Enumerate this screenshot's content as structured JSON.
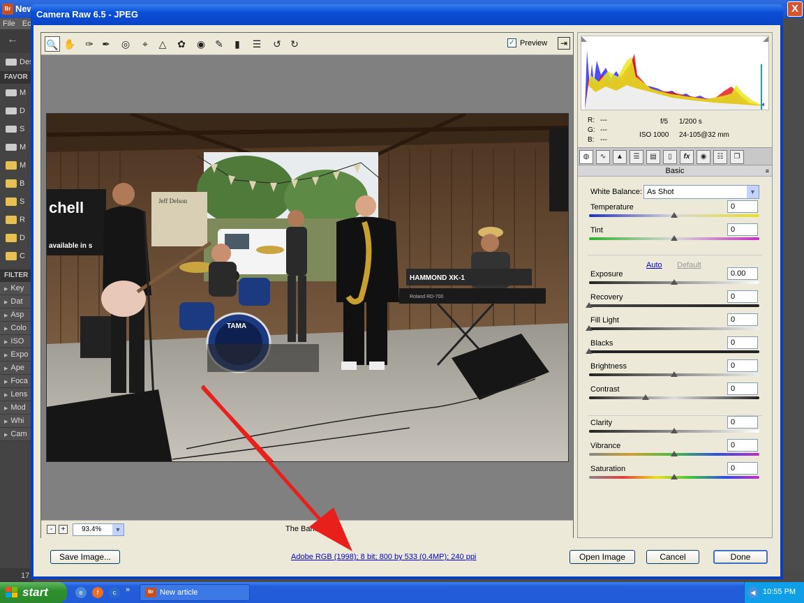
{
  "bg_app": {
    "title": "New",
    "logo": "Br",
    "close": "X",
    "menu": [
      "File",
      "Ec"
    ],
    "sidebar_items": [
      {
        "label": "Des",
        "icon": "desktop-icon"
      },
      {
        "label": "FAVOR",
        "header": true
      },
      {
        "label": "M",
        "icon": "computer-icon"
      },
      {
        "label": "D",
        "icon": "drive-icon"
      },
      {
        "label": "S",
        "icon": "drive-icon"
      },
      {
        "label": "M",
        "icon": "drive-icon"
      },
      {
        "label": "M",
        "icon": "folder-icon"
      },
      {
        "label": "B",
        "icon": "folder-icon"
      },
      {
        "label": "S",
        "icon": "folder-icon"
      },
      {
        "label": "R",
        "icon": "folder-icon"
      },
      {
        "label": "D",
        "icon": "folder-icon"
      },
      {
        "label": "C",
        "icon": "folder-icon"
      }
    ],
    "filter_header": "FILTER",
    "filters": [
      "Key",
      "Dat",
      "Asp",
      "Colo",
      "ISO",
      "Expo",
      "Ape",
      "Foca",
      "Lens",
      "Mod",
      "Whi",
      "Cam"
    ],
    "bottom_count": "17"
  },
  "dialog": {
    "title": "Camera Raw 6.5  -  JPEG",
    "preview_label": "Preview",
    "preview_checked": true,
    "zoom_minus": "-",
    "zoom_plus": "+",
    "zoom_value": "93.4%",
    "filename": "The Band.jpg",
    "tools": [
      "zoom-tool-icon",
      "hand-tool-icon",
      "white-balance-tool-icon",
      "color-sampler-tool-icon",
      "targeted-adjustment-tool-icon",
      "crop-tool-icon",
      "straighten-tool-icon",
      "spot-removal-tool-icon",
      "red-eye-tool-icon",
      "adjustment-brush-icon",
      "graduated-filter-icon",
      "preferences-icon",
      "rotate-left-icon",
      "rotate-right-icon"
    ],
    "readout": {
      "r": "R:",
      "g": "G:",
      "b": "B:",
      "dash": "---",
      "aperture": "f/5",
      "shutter": "1/200 s",
      "iso": "ISO 1000",
      "lens": "24-105@32 mm"
    },
    "panel_name": "Basic",
    "panel_tabs": [
      "basic-tab-icon",
      "tone-curve-tab-icon",
      "detail-tab-icon",
      "hsl-tab-icon",
      "split-toning-tab-icon",
      "lens-corrections-tab-icon",
      "effects-tab-icon",
      "camera-calibration-tab-icon",
      "presets-tab-icon",
      "snapshots-tab-icon"
    ],
    "fx_label": "fx",
    "white_balance_label": "White Balance:",
    "white_balance_value": "As Shot",
    "auto_label": "Auto",
    "default_label": "Default",
    "controls": [
      {
        "name": "temperature",
        "label": "Temperature",
        "value": "0",
        "pos": 0.5
      },
      {
        "name": "tint",
        "label": "Tint",
        "value": "0",
        "pos": 0.5
      },
      {
        "name": "exposure",
        "label": "Exposure",
        "value": "0.00",
        "pos": 0.5
      },
      {
        "name": "recovery",
        "label": "Recovery",
        "value": "0",
        "pos": 0.0
      },
      {
        "name": "fill-light",
        "label": "Fill Light",
        "value": "0",
        "pos": 0.0
      },
      {
        "name": "blacks",
        "label": "Blacks",
        "value": "0",
        "pos": 0.0
      },
      {
        "name": "brightness",
        "label": "Brightness",
        "value": "0",
        "pos": 0.5
      },
      {
        "name": "contrast",
        "label": "Contrast",
        "value": "0",
        "pos": 0.33
      },
      {
        "name": "clarity",
        "label": "Clarity",
        "value": "0",
        "pos": 0.5
      },
      {
        "name": "vibrance",
        "label": "Vibrance",
        "value": "0",
        "pos": 0.5
      },
      {
        "name": "saturation",
        "label": "Saturation",
        "value": "0",
        "pos": 0.5
      }
    ],
    "buttons": {
      "save": "Save Image...",
      "open": "Open Image",
      "cancel": "Cancel",
      "done": "Done"
    },
    "info_link": "Adobe RGB (1998); 8 bit; 800 by 533 (0.4MP); 240 ppi",
    "photo_texts": {
      "poster1": "chell",
      "poster1b": "available in s",
      "poster2": "Jeff Delson",
      "drum": "TAMA",
      "organ": "HAMMOND XK-1",
      "keys": "Roland RD-700"
    }
  },
  "taskbar": {
    "start": "start",
    "task_label": "New article",
    "task_logo": "Br",
    "clock": "10:55 PM",
    "overflow": "»"
  },
  "colors": {
    "xp_blue": "#0a44c8",
    "dialog_bg": "#ece9d8",
    "arrow_red": "#e8201c"
  }
}
